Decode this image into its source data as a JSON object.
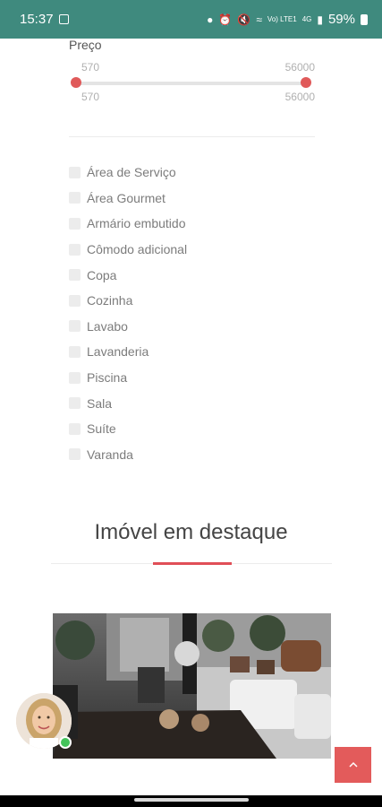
{
  "status_bar": {
    "time": "15:37",
    "network_label": "Vo) LTE1",
    "signal_label": "4G",
    "battery": "59%"
  },
  "filters": {
    "price": {
      "label": "Preço",
      "min": "570",
      "max": "56000",
      "selected_min": "570",
      "selected_max": "56000",
      "range_fraction": [
        0,
        1
      ]
    },
    "features": [
      "Área de Serviço",
      "Área Gourmet",
      "Armário embutido",
      "Cômodo adicional",
      "Copa",
      "Cozinha",
      "Lavabo",
      "Lavanderia",
      "Piscina",
      "Sala",
      "Suíte",
      "Varanda"
    ]
  },
  "featured": {
    "title": "Imóvel em destaque"
  },
  "colors": {
    "status_bar": "#3f8a7e",
    "accent": "#e04f57",
    "online": "#44c35a"
  },
  "icons": {
    "scroll_top": "chevron-up-icon",
    "avatar": "agent-avatar"
  }
}
